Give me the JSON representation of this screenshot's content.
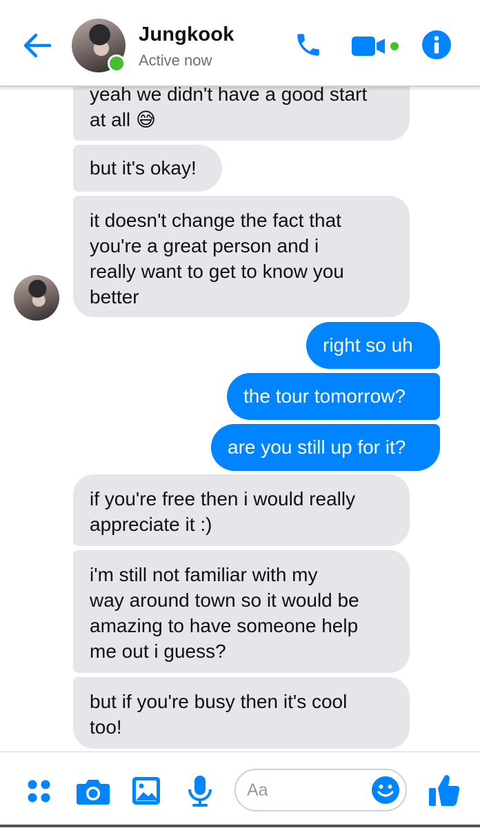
{
  "header": {
    "contact_name": "Jungkook",
    "status": "Active now",
    "icons": [
      "back-arrow-icon",
      "phone-icon",
      "video-camera-icon",
      "info-icon"
    ],
    "accent_color": "#0084ff",
    "online_color": "#44be2d"
  },
  "messages": [
    {
      "side": "received",
      "text": "yeah we didn't have a good start\nat all 😅"
    },
    {
      "side": "received",
      "text": "but it's okay!"
    },
    {
      "side": "received",
      "text": "it doesn't change the fact that\nyou're a great person and i\nreally want to get to know you\nbetter"
    },
    {
      "side": "sent",
      "text": "right so uh"
    },
    {
      "side": "sent",
      "text": "the tour tomorrow?"
    },
    {
      "side": "sent",
      "text": "are you still up for it?"
    },
    {
      "side": "received",
      "text": "if you're free then i would really\nappreciate it :)"
    },
    {
      "side": "received",
      "text": "i'm still not familiar with my\nway around town so it would be\namazing to have someone help\nme out i guess?"
    },
    {
      "side": "received",
      "text": "but if you're busy then it's cool\ntoo!"
    }
  ],
  "composer": {
    "placeholder": "Aa",
    "icons": [
      "apps-icon",
      "camera-icon",
      "gallery-icon",
      "microphone-icon",
      "emoji-icon",
      "thumbs-up-icon"
    ]
  }
}
